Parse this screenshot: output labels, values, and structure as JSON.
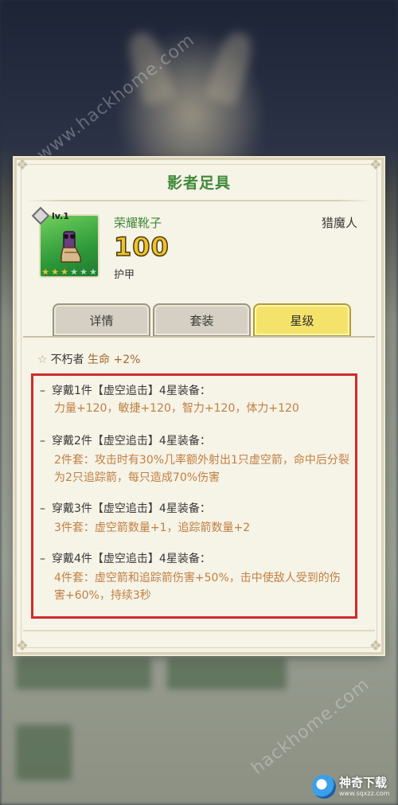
{
  "dialog": {
    "title": "影者足具"
  },
  "item": {
    "name": "荣耀靴子",
    "class": "猎魔人",
    "power": "100",
    "stat_type": "护甲",
    "level": "lv.1",
    "stars_filled": 3,
    "stars_total": 6,
    "icon": "boot-icon"
  },
  "tabs": [
    {
      "label": "详情",
      "active": false
    },
    {
      "label": "套装",
      "active": false
    },
    {
      "label": "星级",
      "active": true
    }
  ],
  "bonus": {
    "name": "不朽者",
    "value": "生命 +2%"
  },
  "sets": [
    {
      "header": "穿戴1件【虚空追击】4星装备：",
      "desc": "力量+120，敏捷+120，智力+120，体力+120"
    },
    {
      "header": "穿戴2件【虚空追击】4星装备：",
      "desc": "2件套：攻击时有30%几率额外射出1只虚空箭，命中后分裂为2只追踪箭，每只造成70%伤害"
    },
    {
      "header": "穿戴3件【虚空追击】4星装备：",
      "desc": "3件套：虚空箭数量+1，追踪箭数量+2"
    },
    {
      "header": "穿戴4件【虚空追击】4星装备：",
      "desc": "4件套：虚空箭和追踪箭伤害+50%，击中使敌人受到的伤害+60%，持续3秒"
    }
  ],
  "watermarks": [
    "www.hackhome.com",
    "hackhome.com"
  ],
  "logo": {
    "main": "神奇下载",
    "sub": "www.sqxzz.com"
  },
  "colors": {
    "title_green": "#3f8a3b",
    "power_gold": "#f0c22a",
    "desc_orange": "#c08042",
    "highlight_red": "#d22a2a",
    "active_tab": "#f4e36a"
  }
}
